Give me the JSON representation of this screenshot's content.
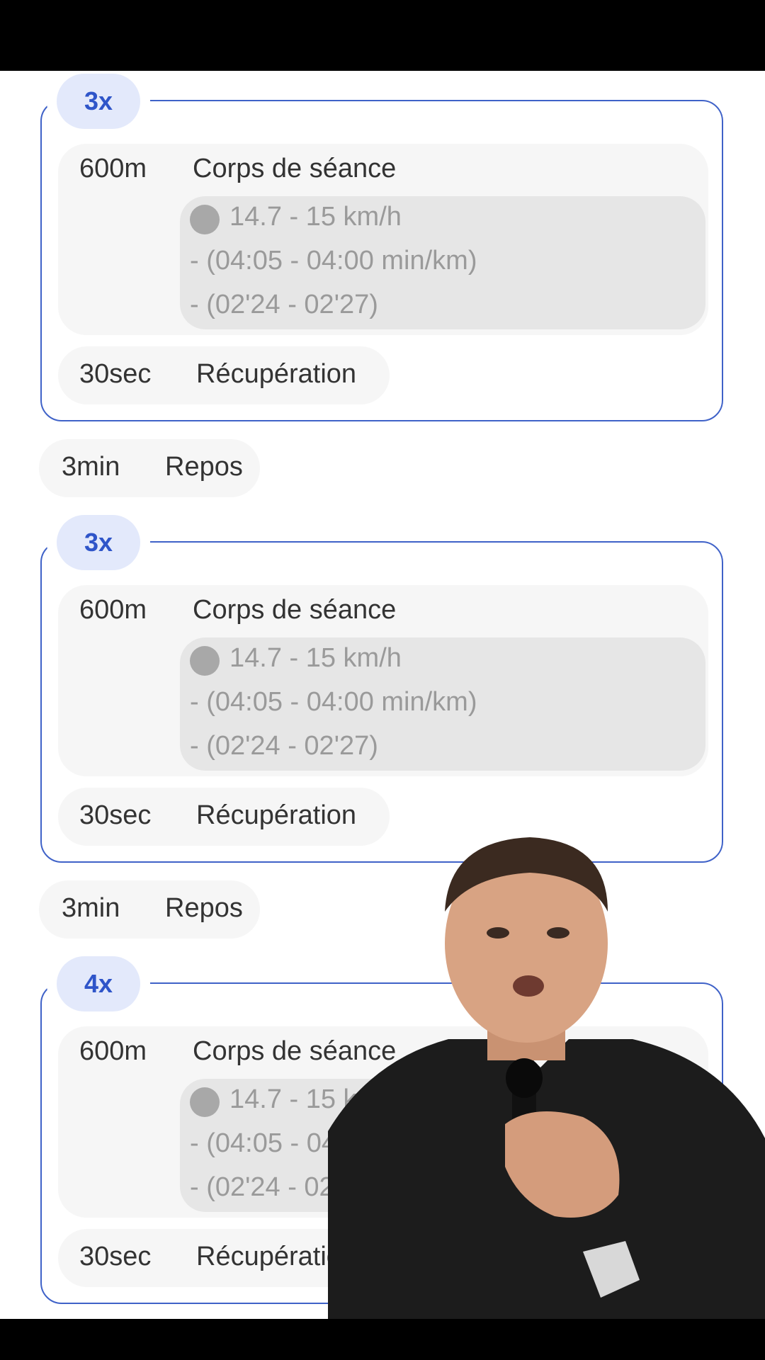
{
  "blocks": [
    {
      "repeat": "3x",
      "work": {
        "distance": "600m",
        "label": "Corps de séance",
        "speed": "14.7 - 15 km/h",
        "pace": "- (04:05 - 04:00 min/km)",
        "split": "- (02'24 - 02'27)"
      },
      "recovery": {
        "duration": "30sec",
        "label": "Récupération"
      }
    },
    {
      "repeat": "3x",
      "work": {
        "distance": "600m",
        "label": "Corps de séance",
        "speed": "14.7 - 15 km/h",
        "pace": "- (04:05 - 04:00 min/km)",
        "split": "- (02'24 - 02'27)"
      },
      "recovery": {
        "duration": "30sec",
        "label": "Récupération"
      }
    },
    {
      "repeat": "4x",
      "work": {
        "distance": "600m",
        "label": "Corps de séance",
        "speed": "14.7 - 15 km/h",
        "pace": "- (04:05 - 04:00 min/km)",
        "split": "- (02'24 - 02'27)"
      },
      "recovery": {
        "duration": "30sec",
        "label": "Récupération"
      }
    }
  ],
  "rests": [
    {
      "duration": "3min",
      "label": "Repos"
    },
    {
      "duration": "3min",
      "label": "Repos"
    }
  ],
  "colors": {
    "accent": "#3f62c8",
    "badge_bg": "#e3e9fb",
    "card_bg": "#f6f6f6",
    "target_bg": "#e6e6e6"
  }
}
